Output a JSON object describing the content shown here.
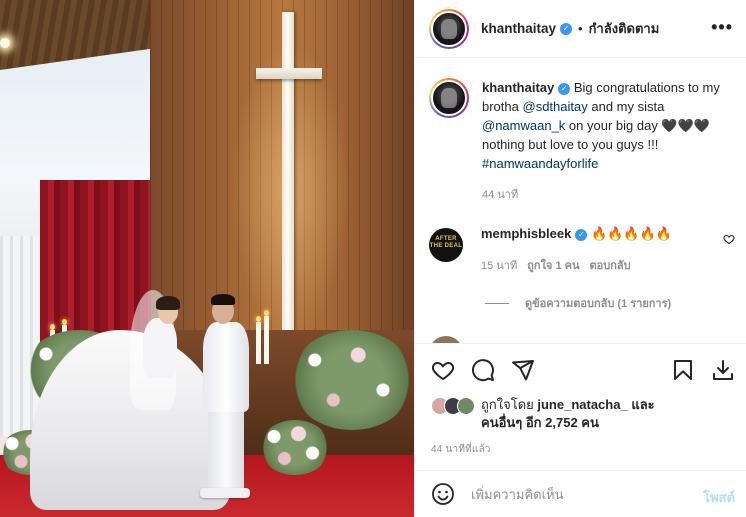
{
  "post": {
    "username": "khanthaitay",
    "follow_status": "กำลังติดตาม",
    "separator": "•",
    "more": "•••"
  },
  "caption": {
    "username": "khanthaitay",
    "text_1": "Big congratulations to my brotha",
    "mention_1": "@sdthaitay",
    "text_2": "and my sista",
    "mention_2": "@namwaan_k",
    "text_3": "on your big day 🖤🖤🖤 nothing but love to you guys !!!",
    "hashtag": "#namwaandayforlife",
    "time": "44 นาที"
  },
  "comment": {
    "username": "memphisbleek",
    "avatar_text": "AFTER THE DEAL",
    "text": "🔥🔥🔥🔥🔥",
    "time": "15 นาที",
    "likes": "ถูกใจ 1 คน",
    "reply": "ตอบกลับ",
    "view_replies": "ดูข้อความตอบกลับ (1 รายการ)"
  },
  "likes": {
    "prefix": "ถูกใจโดย",
    "user": "june_natacha_",
    "and": "และ",
    "others": "คนอื่นๆ อีก 2,752 คน"
  },
  "time_ago": "44 นาทีที่แล้ว",
  "add_comment": {
    "placeholder": "เพิ่มความคิดเห็น",
    "post_button": "โพสต์"
  },
  "colors": {
    "link": "#00376b",
    "verified": "#3897f0",
    "muted": "#8e8e8e",
    "post_disabled": "#b2dffc"
  }
}
